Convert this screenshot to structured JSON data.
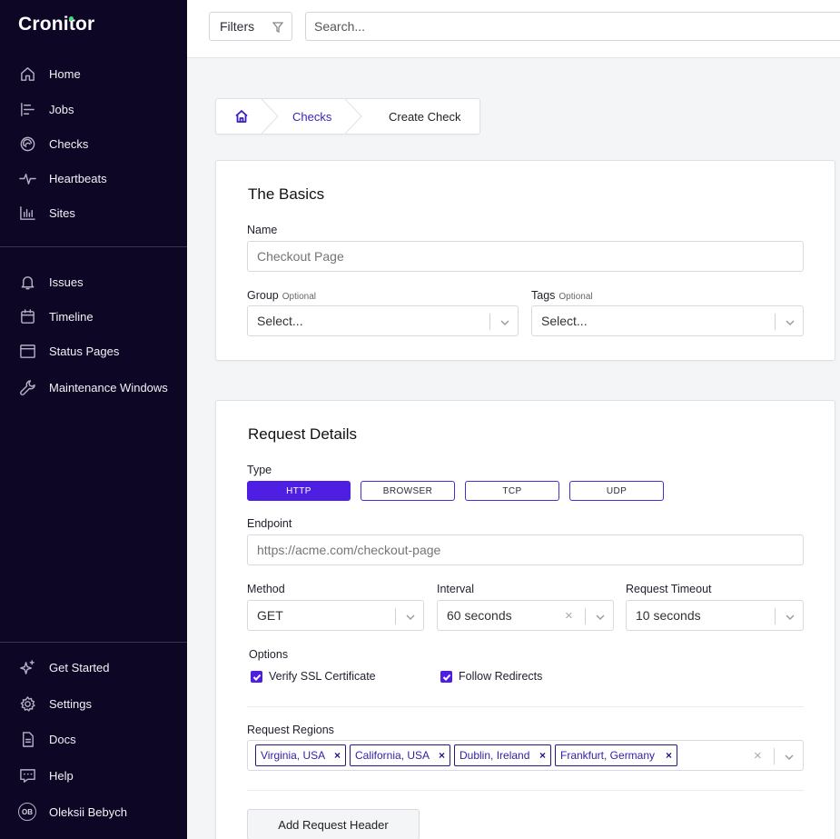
{
  "app": {
    "name": "Cronitor"
  },
  "sidebar": {
    "primary": [
      {
        "label": "Home",
        "icon": "home-icon"
      },
      {
        "label": "Jobs",
        "icon": "jobs-icon"
      },
      {
        "label": "Checks",
        "icon": "checks-icon"
      },
      {
        "label": "Heartbeats",
        "icon": "heartbeat-icon"
      },
      {
        "label": "Sites",
        "icon": "sites-icon"
      }
    ],
    "secondary": [
      {
        "label": "Issues",
        "icon": "bell-icon"
      },
      {
        "label": "Timeline",
        "icon": "calendar-icon"
      },
      {
        "label": "Status Pages",
        "icon": "window-icon"
      },
      {
        "label": "Maintenance Windows",
        "icon": "wrench-icon"
      }
    ],
    "footer": [
      {
        "label": "Get Started",
        "icon": "sparkle-icon"
      },
      {
        "label": "Settings",
        "icon": "gear-icon"
      },
      {
        "label": "Docs",
        "icon": "document-icon"
      },
      {
        "label": "Help",
        "icon": "chat-icon"
      }
    ],
    "user": {
      "name": "Oleksii Bebych",
      "initials": "OB"
    }
  },
  "topbar": {
    "filters_label": "Filters",
    "search_placeholder": "Search..."
  },
  "breadcrumb": {
    "checks": "Checks",
    "current": "Create Check"
  },
  "basics": {
    "title": "The Basics",
    "name_label": "Name",
    "name_placeholder": "Checkout Page",
    "group_label": "Group",
    "group_optional": "Optional",
    "group_placeholder": "Select...",
    "tags_label": "Tags",
    "tags_optional": "Optional",
    "tags_placeholder": "Select..."
  },
  "request": {
    "title": "Request Details",
    "type_label": "Type",
    "types": [
      "HTTP",
      "BROWSER",
      "TCP",
      "UDP"
    ],
    "active_type": "HTTP",
    "endpoint_label": "Endpoint",
    "endpoint_placeholder": "https://acme.com/checkout-page",
    "method_label": "Method",
    "method_value": "GET",
    "interval_label": "Interval",
    "interval_value": "60 seconds",
    "timeout_label": "Request Timeout",
    "timeout_value": "10 seconds",
    "options_label": "Options",
    "options": [
      {
        "label": "Verify SSL Certificate",
        "checked": true
      },
      {
        "label": "Follow Redirects",
        "checked": true
      }
    ],
    "regions_label": "Request Regions",
    "regions": [
      "Virginia, USA",
      "California, USA",
      "Dublin, Ireland",
      "Frankfurt, Germany"
    ],
    "add_header_label": "Add Request Header"
  },
  "colors": {
    "sidebar_bg": "#0d0625",
    "accent": "#4e1fe2",
    "link": "#3a1fb8"
  }
}
